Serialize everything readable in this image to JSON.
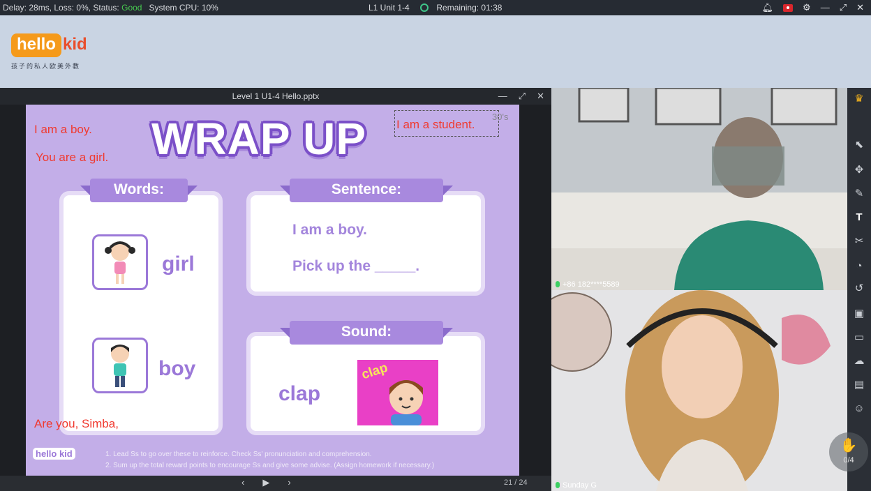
{
  "statusbar": {
    "delay": "Delay: 28ms",
    "loss": "Loss: 0%",
    "status_label": "Status:",
    "status_value": "Good",
    "cpu": "System CPU: 10%",
    "lesson": "L1 Unit 1-4",
    "remaining": "Remaining: 01:38",
    "status_good_color": "#47c84f"
  },
  "logo": {
    "hello": "hello",
    "kid": "kid",
    "tagline": "孩子的私人欧美外教"
  },
  "slide_window": {
    "title": "Level 1 U1-4 Hello.pptx",
    "slide_counter": "21 / 24"
  },
  "slide": {
    "title": "WRAP UP",
    "notes": [
      "I am a boy.",
      "You are a girl.",
      "I am a student.",
      "Are you, Simba,"
    ],
    "timer": "30's",
    "words_header": "Words:",
    "words": [
      "girl",
      "boy"
    ],
    "sentence_header": "Sentence:",
    "sentences": [
      "I am a boy.",
      "Pick up the _____."
    ],
    "sound_header": "Sound:",
    "sound_word": "clap",
    "sound_image_text": "clap",
    "footer_logo": "hello kid",
    "footer_lines": [
      "1. Lead Ss to go over these to reinforce. Check Ss' pronunciation and comprehension.",
      "2. Sum up the total reward points to encourage Ss and give some advise. (Assign homework if necessary.)"
    ]
  },
  "videos": {
    "student_label": "+86 182****5589",
    "teacher_label": "Sunday G"
  },
  "toolbar": {
    "icons": [
      "crown-icon",
      "pointer-icon",
      "move-icon",
      "pen-icon",
      "text-icon",
      "scissors-icon",
      "bucket-icon",
      "undo-icon",
      "image-icon",
      "chat-icon",
      "cloud-icon",
      "briefcase-icon",
      "users-icon"
    ]
  },
  "hand": {
    "count": "0/4"
  }
}
